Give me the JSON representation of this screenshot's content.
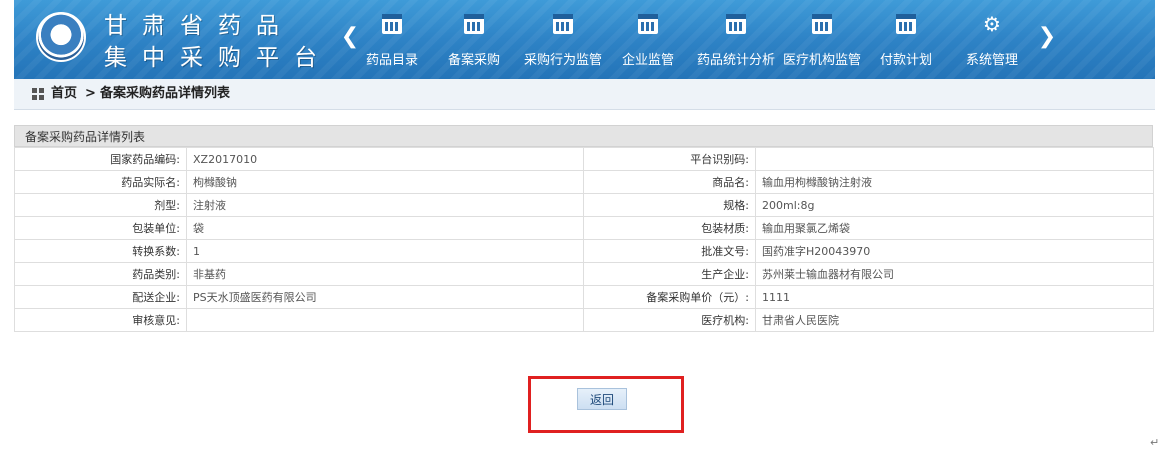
{
  "header": {
    "logo_line1": "甘肃省药品",
    "logo_line2": "集中采购平台",
    "nav": [
      {
        "label": "药品目录",
        "icon": "calendar-icon"
      },
      {
        "label": "备案采购",
        "icon": "calendar-icon"
      },
      {
        "label": "采购行为监管",
        "icon": "calendar-icon"
      },
      {
        "label": "企业监管",
        "icon": "calendar-icon"
      },
      {
        "label": "药品统计分析",
        "icon": "calendar-icon"
      },
      {
        "label": "医疗机构监管",
        "icon": "calendar-icon"
      },
      {
        "label": "付款计划",
        "icon": "calendar-icon"
      },
      {
        "label": "系统管理",
        "icon": "gear-icon"
      }
    ],
    "prev_arrow": "❮",
    "next_arrow": "❯"
  },
  "breadcrumb": {
    "home": "首页",
    "separator": ">",
    "current": "备案采购药品详情列表"
  },
  "panel": {
    "title": "备案采购药品详情列表",
    "rows": [
      {
        "l1": "国家药品编码:",
        "v1": "XZ2017010",
        "l2": "平台识别码:",
        "v2": ""
      },
      {
        "l1": "药品实际名:",
        "v1": "枸橼酸钠",
        "l2": "商品名:",
        "v2": "输血用枸橼酸钠注射液"
      },
      {
        "l1": "剂型:",
        "v1": "注射液",
        "l2": "规格:",
        "v2": "200ml:8g"
      },
      {
        "l1": "包装单位:",
        "v1": "袋",
        "l2": "包装材质:",
        "v2": "输血用聚氯乙烯袋"
      },
      {
        "l1": "转换系数:",
        "v1": "1",
        "l2": "批准文号:",
        "v2": "国药准字H20043970"
      },
      {
        "l1": "药品类别:",
        "v1": "非基药",
        "l2": "生产企业:",
        "v2": "苏州莱士输血器材有限公司"
      },
      {
        "l1": "配送企业:",
        "v1": "PS天水顶盛医药有限公司",
        "l2": "备案采购单价（元）:",
        "v2": "1111"
      },
      {
        "l1": "审核意见:",
        "v1": "",
        "l2": "医疗机构:",
        "v2": "甘肃省人民医院"
      }
    ]
  },
  "return_button": "返回",
  "colors": {
    "header_blue": "#2e83c6",
    "highlight_red": "#e02020"
  },
  "return_mark": "↵"
}
